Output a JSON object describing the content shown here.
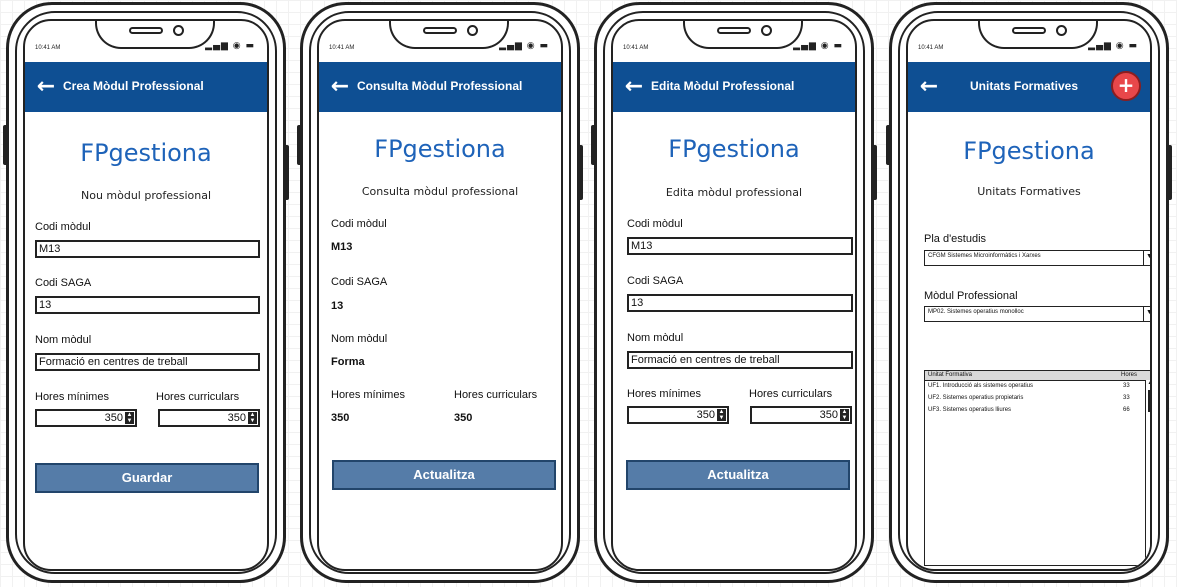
{
  "status": {
    "time": "10:41 AM",
    "icons": "signal-wifi-battery"
  },
  "brand": "FPgestiona",
  "screens": {
    "create": {
      "title": "Crea Mòdul Professional",
      "subtitle": "Nou mòdul professional",
      "codi_label": "Codi mòdul",
      "codi_value": "M13",
      "saga_label": "Codi SAGA",
      "saga_value": "13",
      "nom_label": "Nom mòdul",
      "nom_value": "Formació en centres de treball",
      "hmin_label": "Hores mínimes",
      "hmin_value": "350",
      "hcur_label": "Hores curriculars",
      "hcur_value": "350",
      "button": "Guardar"
    },
    "consult": {
      "title": "Consulta Mòdul Professional",
      "subtitle": "Consulta mòdul professional",
      "codi_label": "Codi mòdul",
      "codi_value": "M13",
      "saga_label": "Codi SAGA",
      "saga_value": "13",
      "nom_label": "Nom mòdul",
      "nom_value": "Forma",
      "hmin_label": "Hores mínimes",
      "hmin_value": "350",
      "hcur_label": "Hores curriculars",
      "hcur_value": "350",
      "button": "Actualitza"
    },
    "edit": {
      "title": "Edita Mòdul Professional",
      "subtitle": "Edita mòdul professional",
      "codi_label": "Codi mòdul",
      "codi_value": "M13",
      "saga_label": "Codi SAGA",
      "saga_value": "13",
      "nom_label": "Nom mòdul",
      "nom_value": "Formació en centres de treball",
      "hmin_label": "Hores mínimes",
      "hmin_value": "350",
      "hcur_label": "Hores curriculars",
      "hcur_value": "350",
      "button": "Actualitza"
    },
    "units": {
      "title": "Unitats Formatives",
      "subtitle": "Unitats Formatives",
      "pla_label": "Pla d'estudis",
      "pla_value": "CFGM Sistemes Microinformàtics i Xarxes",
      "modul_label": "Mòdul Professional",
      "modul_value": "MP02. Sistemes operatius monolloc",
      "table": {
        "headers": [
          "Unitat Formativa",
          "Hores"
        ],
        "rows": [
          [
            "UF1. Introducció als sistemes operatius",
            "33"
          ],
          [
            "UF2. Sistemes operatius propietaris",
            "33"
          ],
          [
            "UF3. Sistemes operatius lliures",
            "66"
          ]
        ]
      },
      "add_symbol": "+"
    }
  },
  "colors": {
    "appbar": "#0e4f93",
    "brand": "#1e63b9",
    "button": "#557ca8",
    "add": "#e8474a"
  }
}
